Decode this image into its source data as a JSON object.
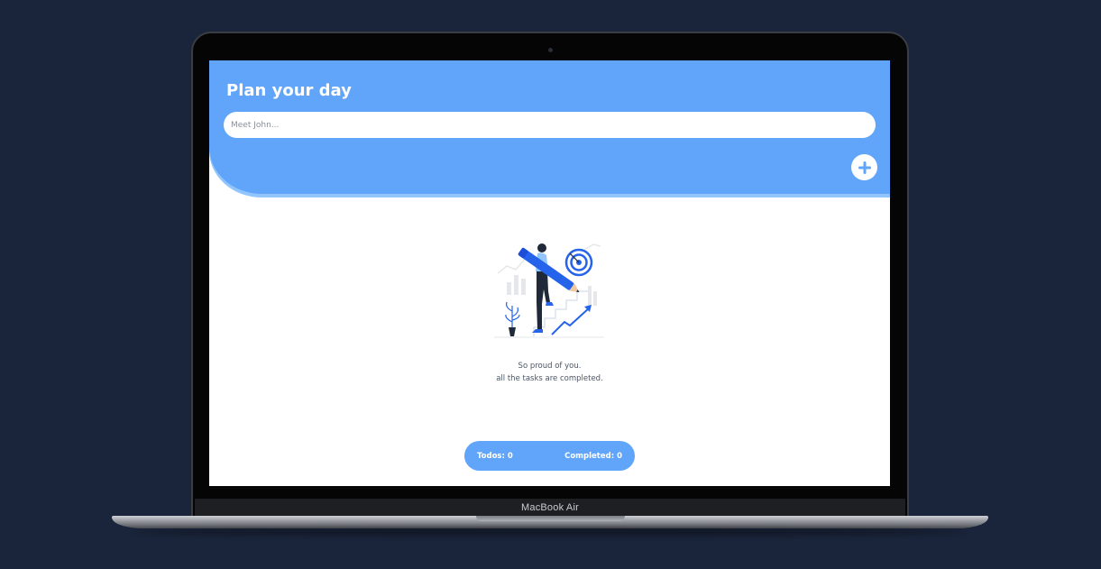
{
  "device": {
    "model_label": "MacBook Air"
  },
  "app": {
    "title": "Plan your day",
    "input": {
      "placeholder": "Meet John...",
      "value": ""
    },
    "add_button": {
      "icon": "plus-icon"
    },
    "empty_state": {
      "illustration": "goal-achievement-illustration",
      "line1": "So proud of you.",
      "line2": "all the tasks are completed."
    },
    "counters": {
      "todos_label": "Todos: 0",
      "completed_label": "Completed: 0"
    }
  },
  "colors": {
    "accent": "#60a5fa",
    "accent_light": "#93c5fd",
    "background": "#1a243a"
  }
}
